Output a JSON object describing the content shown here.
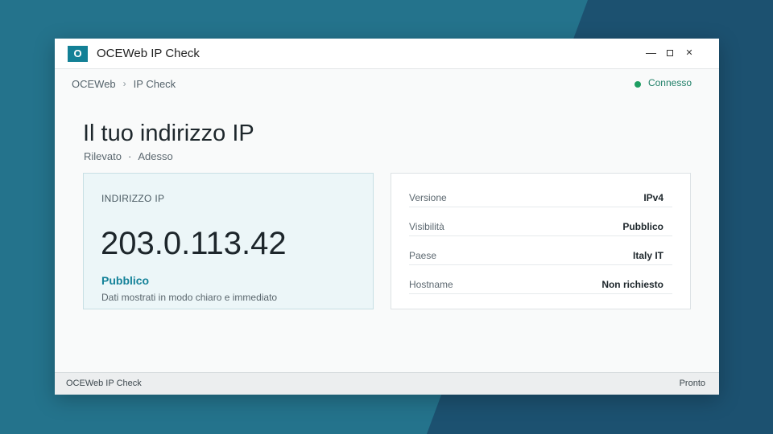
{
  "window": {
    "app_icon_letter": "O",
    "title": "OCEWeb IP Check"
  },
  "breadcrumb": [
    "OCEWeb",
    "IP Check"
  ],
  "breadcrumb_separator": "›",
  "connection": {
    "label": "Connesso",
    "color": "#1e9e62"
  },
  "page": {
    "title": "Il tuo indirizzo IP",
    "detected_label": "Rilevato",
    "separator": "·",
    "detected_when": "Adesso"
  },
  "ip_card": {
    "label": "INDIRIZZO IP",
    "value": "203.0.113.42",
    "type": "Pubblico",
    "note": "Dati mostrati in modo chiaro e immediato"
  },
  "details": [
    {
      "key": "Versione",
      "value": "IPv4"
    },
    {
      "key": "Visibilità",
      "value": "Pubblico"
    },
    {
      "key": "Paese",
      "value": "Italy  IT"
    },
    {
      "key": "Hostname",
      "value": "Non richiesto"
    }
  ],
  "statusbar": {
    "left": "OCEWeb IP Check",
    "right": "Pronto"
  },
  "colors": {
    "accent": "#138096",
    "background": "#24738c"
  },
  "icons": {
    "minimize": "minimize-icon",
    "maximize": "maximize-icon",
    "close": "close-icon"
  }
}
